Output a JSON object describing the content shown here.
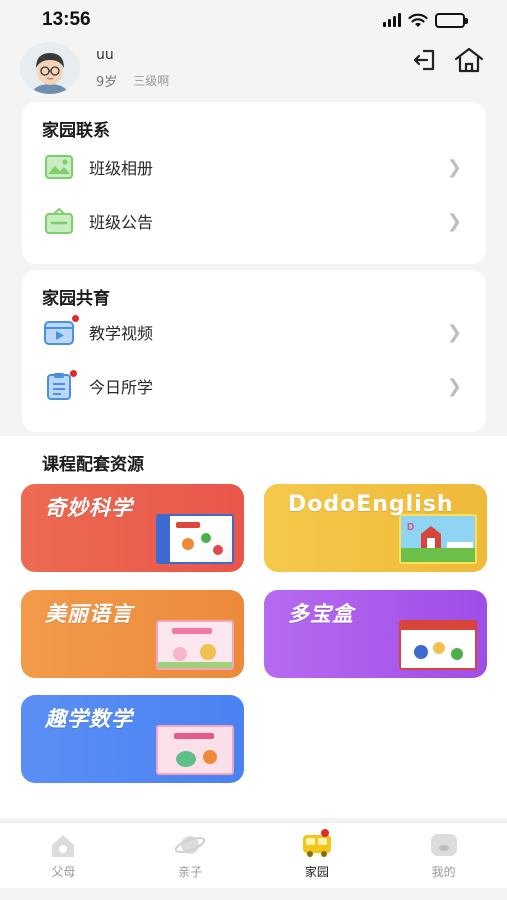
{
  "status_bar": {
    "time": "13:56"
  },
  "profile": {
    "name": "uu",
    "age": "9岁",
    "level": "三级啊"
  },
  "contact": {
    "title": "家园联系",
    "items": [
      {
        "label": "班级相册",
        "icon": "photo-album-icon",
        "color": "#7ccf6b"
      },
      {
        "label": "班级公告",
        "icon": "announcement-icon",
        "color": "#7ccf6b"
      }
    ]
  },
  "coedu": {
    "title": "家园共育",
    "items": [
      {
        "label": "教学视频",
        "icon": "video-icon",
        "color": "#4a90e2",
        "has_dot": true
      },
      {
        "label": "今日所学",
        "icon": "notebook-icon",
        "color": "#4a90e2",
        "has_dot": true
      }
    ]
  },
  "resources": {
    "title": "课程配套资源",
    "tiles": [
      {
        "title": "奇妙科学",
        "color": "#e9564a"
      },
      {
        "title": "DodoEnglish",
        "color": "#f0b93a"
      },
      {
        "title": "美丽语言",
        "color": "#ec8a3a"
      },
      {
        "title": "多宝盒",
        "color": "#9f4de8"
      },
      {
        "title": "趣学数学",
        "color": "#4a82f2"
      }
    ]
  },
  "tabbar": {
    "tabs": [
      {
        "label": "父母",
        "icon": "parents-icon",
        "active": false
      },
      {
        "label": "亲子",
        "icon": "planet-icon",
        "active": false
      },
      {
        "label": "家园",
        "icon": "bus-icon",
        "active": true,
        "has_dot": true
      },
      {
        "label": "我的",
        "icon": "profile-icon",
        "active": false
      }
    ]
  },
  "colors": {
    "accent": "#f5c518",
    "badge": "#e02b2b",
    "background": "#f4f4f4"
  }
}
